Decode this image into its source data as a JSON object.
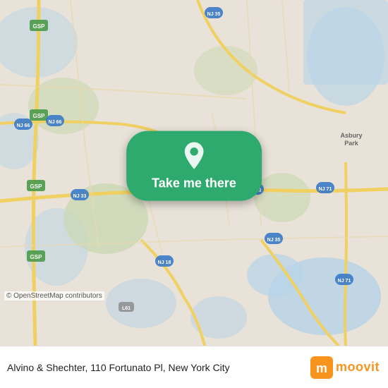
{
  "map": {
    "alt": "Map of New Jersey showing location",
    "osm_credit": "© OpenStreetMap contributors"
  },
  "cta": {
    "button_label": "Take me there"
  },
  "bottom_bar": {
    "address": "Alvino & Shechter, 110 Fortunato Pl, New York City",
    "moovit_label": "moovit"
  }
}
